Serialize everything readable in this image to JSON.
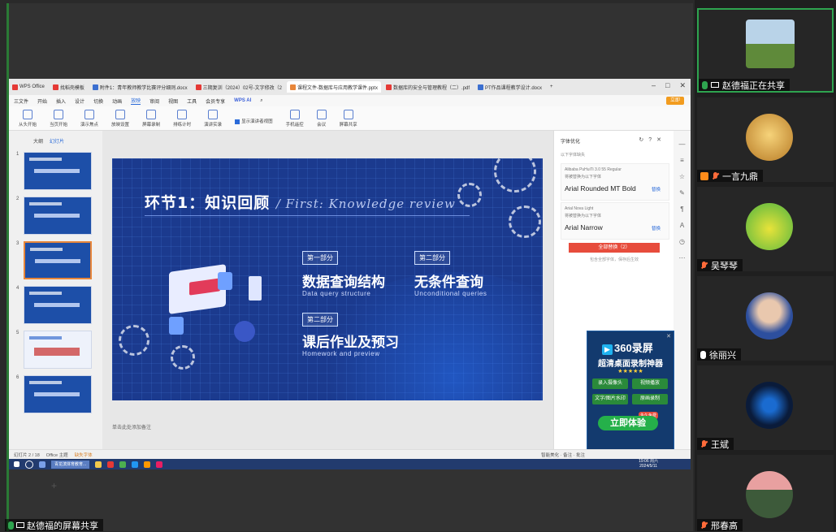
{
  "share": {
    "caption": "赵德福的屏幕共享"
  },
  "tabs": [
    {
      "label": "WPS Office",
      "color": "#e53935"
    },
    {
      "label": "",
      "color": "#e53935"
    },
    {
      "label": "找稻壳模板",
      "color": "#e53935"
    },
    {
      "label": "附件1：青年教师教学比赛评分细则.docx",
      "color": "#3b6fd0"
    },
    {
      "label": "三期复训（2024）02号-文字修改（2",
      "color": "#e53935"
    },
    {
      "label": "课程文件-数据库与应用教学课件.pptx",
      "color": "#e8863a"
    },
    {
      "label": "数据库的安全与管理教程（二）.pdf",
      "color": "#e53935"
    },
    {
      "label": "PT作品课程教学设计.docx",
      "color": "#3b6fd0"
    }
  ],
  "menu": [
    "三文件",
    "开始",
    "插入",
    "设计",
    "切换",
    "动画",
    "放映",
    "审阅",
    "视图",
    "工具",
    "会员专享"
  ],
  "menu_active": "放映",
  "wps_ai": "WPS AI",
  "go_vip": "立即",
  "ribbon": [
    "从头开始",
    "当页开始",
    "演示焦点",
    "放映设置",
    "屏幕录制",
    "排练计时",
    "演讲实录",
    "手机遥控",
    "会议",
    "屏幕共享"
  ],
  "ribbon_check": "显示演讲者视图",
  "left_tabs": [
    "大纲",
    "幻灯片"
  ],
  "slides": [
    {
      "num": "1",
      "style": "dark"
    },
    {
      "num": "2",
      "style": "dark"
    },
    {
      "num": "3",
      "style": "dark",
      "selected": true
    },
    {
      "num": "4",
      "style": "dark"
    },
    {
      "num": "5",
      "style": "light"
    },
    {
      "num": "6",
      "style": "dark"
    }
  ],
  "slide": {
    "title_cn": "环节1：知识回顾",
    "title_en": "/ First: Knowledge review",
    "parts": [
      {
        "badge": "第一部分",
        "title": "数据查询结构",
        "sub": "Data query structure"
      },
      {
        "badge": "第二部分",
        "title": "无条件查询",
        "sub": "Unconditional queries"
      },
      {
        "badge": "第二部分",
        "title": "课后作业及预习",
        "sub": "Homework and preview"
      }
    ]
  },
  "notes": "单击此处添加备注",
  "right_panel": {
    "title": "字体优化",
    "subtitle": "以下字体缺失",
    "fonts": [
      {
        "name": "Alibaba PuHuiTi 3.0 55 Regular",
        "hint": "将被替换为以下字体",
        "replace": "Arial Rounded MT Bold",
        "link": "替换"
      },
      {
        "name": "Arial Nova Light",
        "hint": "将被替换为以下字体",
        "replace": "Arial Narrow",
        "link": "替换"
      }
    ],
    "button": "全部替换（2）",
    "hint": "包含全部字体，保存后生效"
  },
  "ad": {
    "logo": "360录屏",
    "title": "超清桌面录制神器",
    "stars": "★★★★★",
    "chips": [
      "录入摄像头",
      "视频播放",
      "文字/图片水印",
      "原画录制"
    ],
    "cta": "立即体验",
    "free": "永久免费"
  },
  "statusbar": {
    "page": "幻灯片 2 / 18",
    "theme": "Office 主题",
    "font": "缺失字体",
    "notes": "备注",
    "comments": "批注",
    "zoom": "智能美化"
  },
  "taskbar": {
    "app": "青龙滨体育教育...",
    "time": "19:06 周六",
    "date": "2024/5/11"
  },
  "participants": [
    {
      "name": "赵德福正在共享",
      "active": true,
      "avatar": "landscape",
      "mic": "on",
      "share": true
    },
    {
      "name": "一言九鼎",
      "avatar": "buddha",
      "mic": "off"
    },
    {
      "name": "吴琴琴",
      "avatar": "chick",
      "mic": "off"
    },
    {
      "name": "徐丽兴",
      "avatar": "man",
      "mic": "on"
    },
    {
      "name": "王斌",
      "avatar": "logo",
      "mic": "off"
    },
    {
      "name": "邢春高",
      "avatar": "road",
      "mic": "off"
    }
  ],
  "colors": {
    "accent": "#2ea44f",
    "slide_bg": "#1b3a8e",
    "menu_active": "#2b6bd9"
  }
}
